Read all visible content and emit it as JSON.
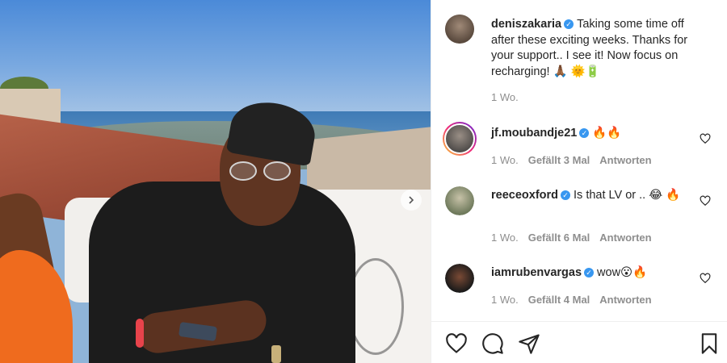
{
  "post": {
    "author": "deniszakaria",
    "caption": "Taking some time off after these exciting weeks. Thanks for your support.. I see it! Now focus on recharging! 🙏🏾 🌞🔋",
    "time": "1 Wo."
  },
  "comments": [
    {
      "username": "jf.moubandje21",
      "text": "🔥🔥",
      "time": "1 Wo.",
      "likes": "Gefällt 3 Mal",
      "reply": "Antworten"
    },
    {
      "username": "reeceoxford",
      "text": "Is that LV or .. 😂 🔥",
      "time": "1 Wo.",
      "likes": "Gefällt 6 Mal",
      "reply": "Antworten"
    },
    {
      "username": "iamrubenvargas",
      "text": "wow😮🔥",
      "time": "1 Wo.",
      "likes": "Gefällt 4 Mal",
      "reply": "Antworten"
    }
  ],
  "icons": {
    "like": "heart-icon",
    "comment": "comment-icon",
    "share": "paper-plane-icon",
    "save": "bookmark-icon",
    "verified": "verified-badge-icon"
  },
  "colors": {
    "verified": "#3897f0",
    "meta": "#8e8e8e",
    "text": "#262626"
  }
}
